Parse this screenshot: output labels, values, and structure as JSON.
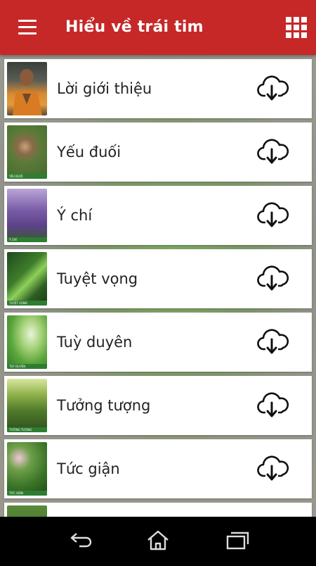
{
  "app": {
    "title": "Hiểu về trái tim"
  },
  "icons": {
    "menu": "menu-icon",
    "grid": "grid-icon",
    "download": "cloud-download-icon"
  },
  "colors": {
    "appbar": "#c62828",
    "item_bg": "#ffffff",
    "text": "#222222"
  },
  "items": [
    {
      "label": "Lời giới thiệu",
      "thumb_caption": ""
    },
    {
      "label": "Yếu đuối",
      "thumb_caption": "YẾU ĐUỐI"
    },
    {
      "label": "Ý chí",
      "thumb_caption": "Ý CHÍ"
    },
    {
      "label": "Tuyệt vọng",
      "thumb_caption": "TUYỆT VỌNG"
    },
    {
      "label": "Tuỳ duyên",
      "thumb_caption": "TÙY DUYÊN"
    },
    {
      "label": "Tưởng tượng",
      "thumb_caption": "TƯỞNG TƯỢNG"
    },
    {
      "label": "Tức giận",
      "thumb_caption": "TỨC GIẬN"
    }
  ],
  "nav": {
    "back": "back-icon",
    "home": "home-icon",
    "recents": "recents-icon"
  }
}
